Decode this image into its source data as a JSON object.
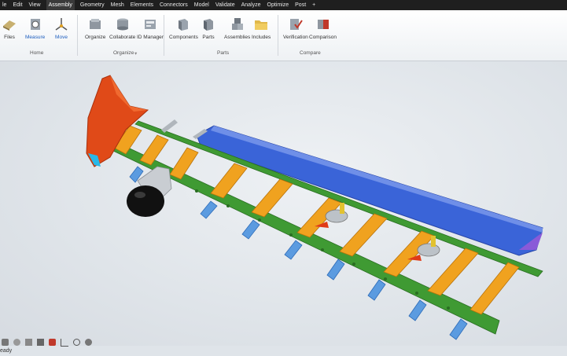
{
  "menubar": {
    "items": [
      "le",
      "Edit",
      "View",
      "Assembly",
      "Geometry",
      "Mesh",
      "Elements",
      "Connectors",
      "Model",
      "Validate",
      "Analyze",
      "Optimize",
      "Post",
      "+"
    ],
    "active": "Assembly"
  },
  "ribbon": {
    "tools": {
      "files": "Files",
      "measure": "Measure",
      "move": "Move",
      "organize": "Organize",
      "collaborate": "Collaborate",
      "id_manager": "ID Manager",
      "components": "Components",
      "parts": "Parts",
      "assemblies": "Assemblies",
      "includes": "Includes",
      "verification": "Verification",
      "comparison": "Comparison"
    },
    "groups": {
      "home": "Home",
      "organize": "Organize",
      "parts": "Parts",
      "compare": "Compare"
    }
  },
  "colors": {
    "spar": "#3f9a33",
    "rib": "#f0a21f",
    "skin": "#3a64d8",
    "winglet": "#e04a18",
    "bracket": "#5b9be0",
    "nose": "#111111"
  },
  "status": {
    "text": "eady"
  }
}
